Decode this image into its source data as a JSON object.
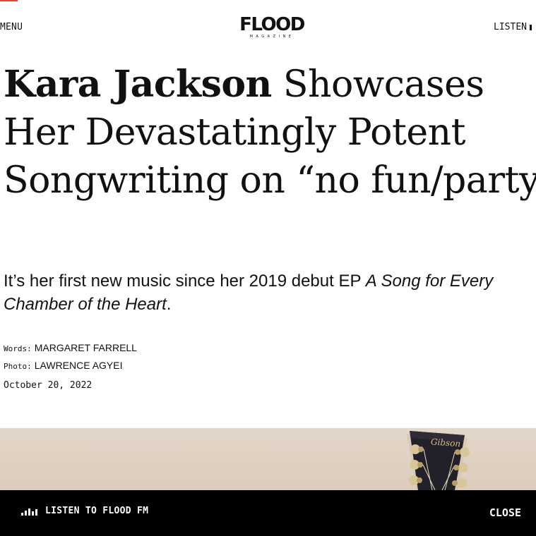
{
  "header": {
    "menu_label": "MENU",
    "logo_text": "FLOOD",
    "logo_subtext": "MAGAZINE",
    "listen_label": "LISTEN",
    "accent_color": "#e8412c"
  },
  "article": {
    "headline_bold": "Kara Jackson",
    "headline_rest": " Showcases Her Devastatingly Potent Songwriting on “no fun/party”",
    "dek_text": "It’s her first new music since her 2019 debut EP ",
    "dek_italic": "A Song for Every Chamber of the Heart",
    "dek_end": ".",
    "words_label": "Words:",
    "words_value": "Margaret Farrell",
    "photo_label": "Photo:",
    "photo_value": "Lawrence Agyei",
    "date": "October 20, 2022"
  },
  "hero_image": {
    "headstock_logo": "Gibson"
  },
  "player": {
    "label": "LISTEN TO FLOOD FM",
    "close_label": "CLOSE",
    "icon": "equalizer-icon"
  }
}
